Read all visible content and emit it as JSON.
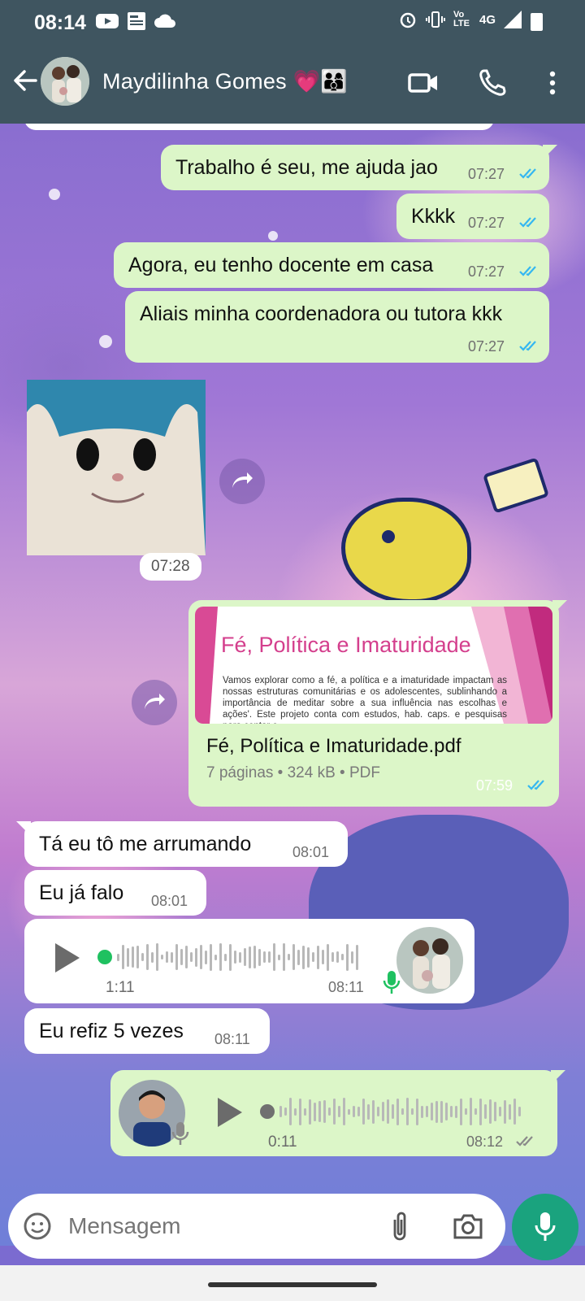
{
  "status": {
    "time": "08:14",
    "network": "4G",
    "volte": "Vo LTE"
  },
  "header": {
    "contact_name": "Maydilinha Gomes 💗👨‍👩‍👦"
  },
  "messages": [
    {
      "type": "text",
      "dir": "out",
      "text": "Trabalho é seu, me ajuda jao",
      "time": "07:27",
      "status": "read"
    },
    {
      "type": "text",
      "dir": "out",
      "text": "Kkkk",
      "time": "07:27",
      "status": "read"
    },
    {
      "type": "text",
      "dir": "out",
      "text": "Agora, eu tenho docente em casa",
      "time": "07:27",
      "status": "read"
    },
    {
      "type": "text",
      "dir": "out",
      "text": "Aliais minha coordenadora ou tutora kkk",
      "time": "07:27",
      "status": "read"
    },
    {
      "type": "sticker",
      "dir": "in",
      "time": "07:28"
    },
    {
      "type": "document",
      "dir": "out",
      "preview_title": "Fé, Política e Imaturidade",
      "preview_text": "Vamos explorar como a fé, a política e a imaturidade impactam as nossas estruturas comunitárias e os adolescentes, sublinhando a importância de meditar sobre a sua influência nas escolhas e ações'. Este projeto conta com estudos, hab. caps. e pesquisas para contar o",
      "filename": "Fé, Política e Imaturidade.pdf",
      "meta": "7 páginas • 324 kB • PDF",
      "time": "07:59",
      "status": "read"
    },
    {
      "type": "text",
      "dir": "in",
      "text": "Tá eu tô me arrumando",
      "time": "08:01"
    },
    {
      "type": "text",
      "dir": "in",
      "text": "Eu já falo",
      "time": "08:01"
    },
    {
      "type": "audio",
      "dir": "in",
      "duration": "1:11",
      "time": "08:11"
    },
    {
      "type": "text",
      "dir": "in",
      "text": "Eu refiz 5 vezes",
      "time": "08:11"
    },
    {
      "type": "audio",
      "dir": "out",
      "duration": "0:11",
      "time": "08:12",
      "status": "delivered"
    }
  ],
  "input": {
    "placeholder": "Mensagem"
  },
  "colors": {
    "header": "#3f5560",
    "outgoing": "#dcf6c8",
    "incoming": "#ffffff",
    "read_ticks": "#34b7f1",
    "accent": "#1aa37e"
  },
  "icons": [
    "back-arrow-icon",
    "video-call-icon",
    "phone-icon",
    "more-vert-icon",
    "forward-icon",
    "play-icon",
    "mic-icon",
    "sticker-icon",
    "attach-icon",
    "camera-icon"
  ]
}
